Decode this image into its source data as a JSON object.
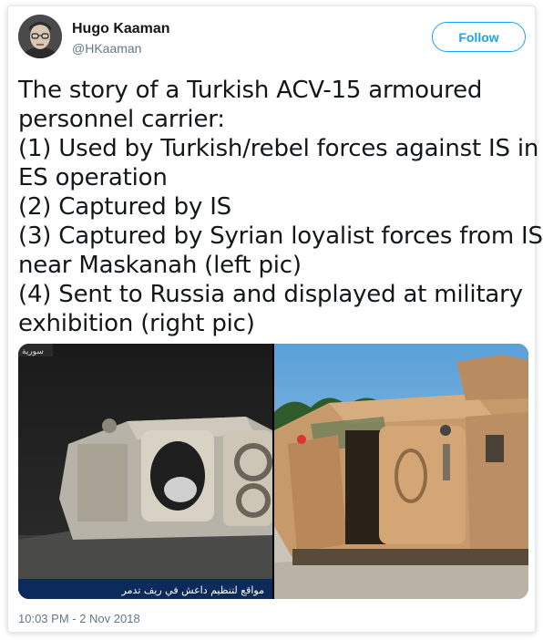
{
  "author": {
    "display_name": "Hugo Kaaman",
    "handle": "@HKaaman"
  },
  "follow_button": {
    "label": "Follow"
  },
  "tweet": {
    "lines": [
      "The story of a Turkish ACV-15 armoured",
      "personnel carrier:",
      "(1) Used by Turkish/rebel forces against IS in",
      "ES operation",
      "(2) Captured by IS",
      "(3) Captured by Syrian loyalist forces from IS",
      "near Maskanah (left pic)",
      "(4) Sent to Russia and displayed at military",
      "exhibition (right pic)"
    ],
    "timestamp": "10:03 PM - 2 Nov 2018"
  },
  "media": {
    "left_image": {
      "caption_text": "مواقع لتنظيم داعش في ريف تدمر",
      "logo_text": "سورية"
    },
    "right_image": {}
  },
  "colors": {
    "accent": "#1da1f2",
    "text": "#14171a",
    "secondary_text": "#657786",
    "border": "#e1e8ed"
  }
}
